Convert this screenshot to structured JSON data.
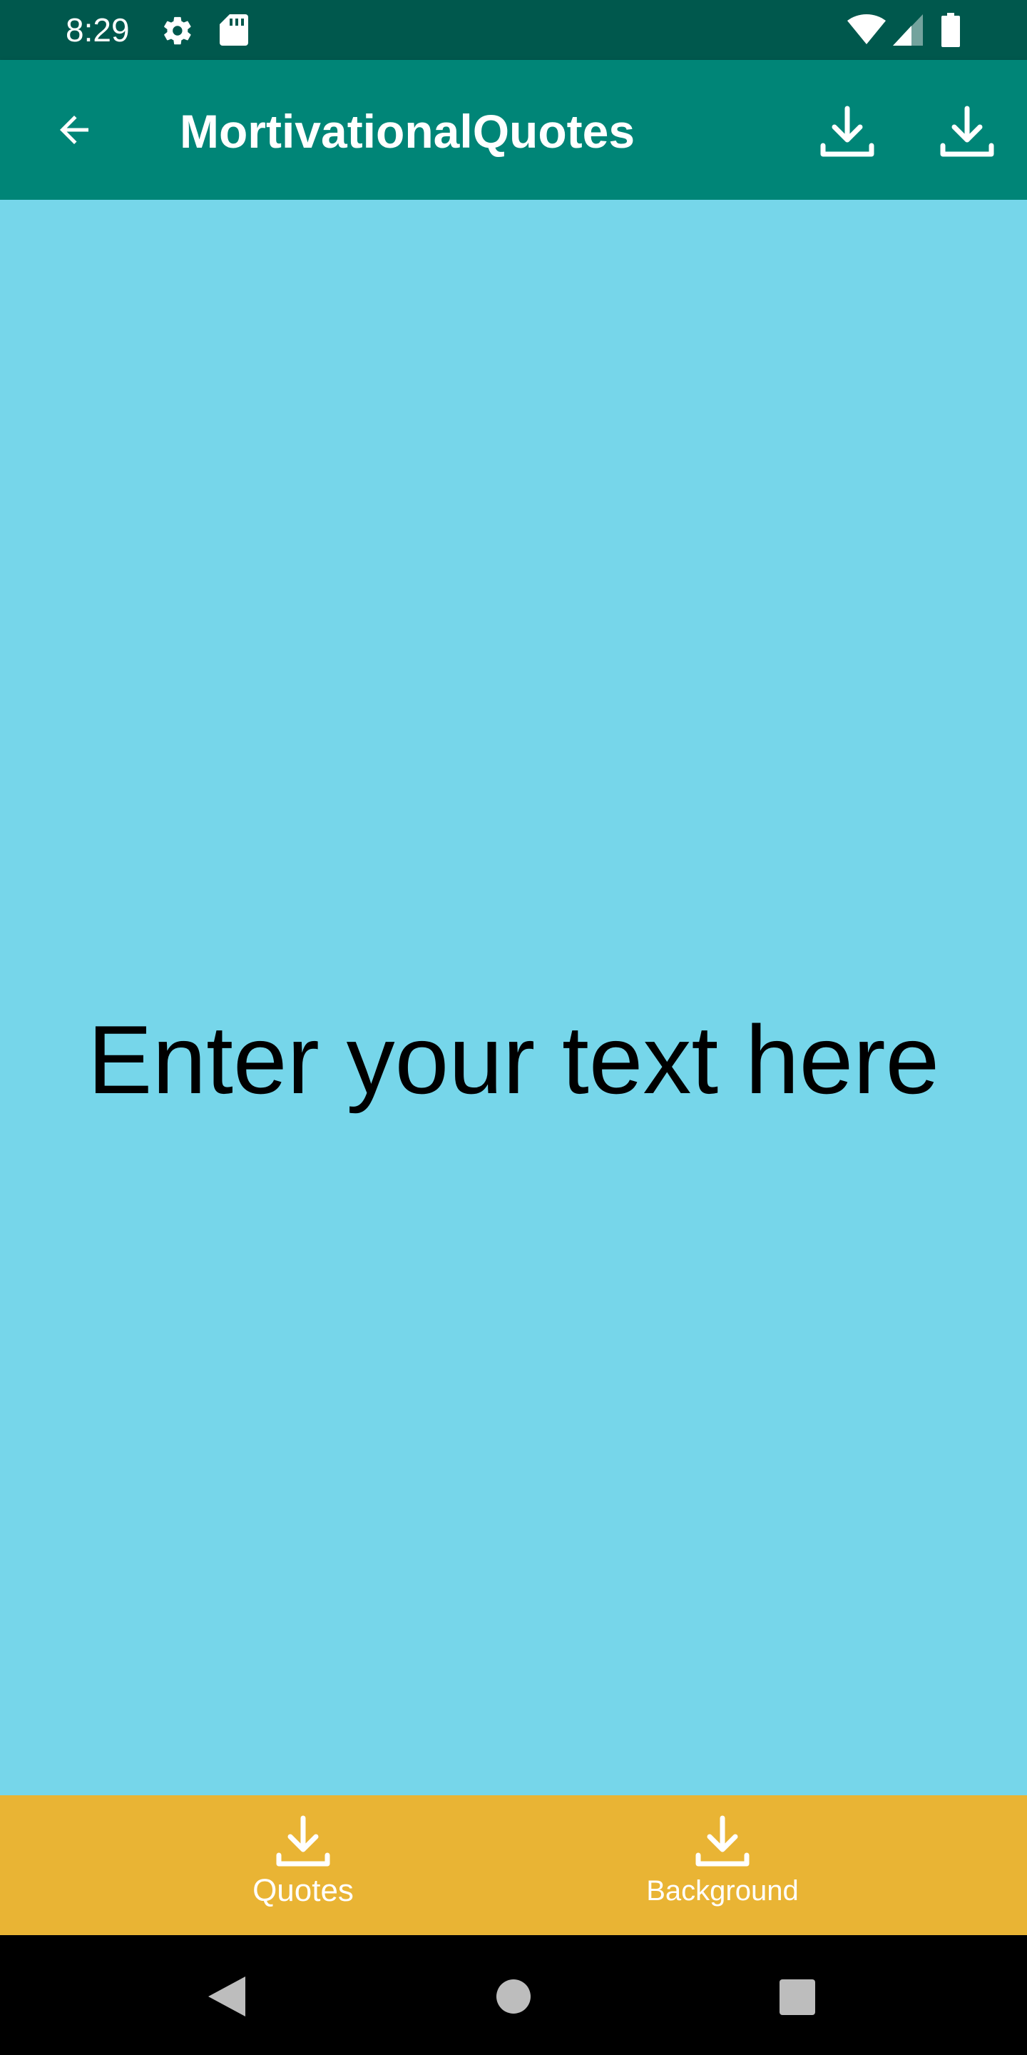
{
  "status_bar": {
    "time": "8:29",
    "icons": [
      "gear-icon",
      "sd-card-icon",
      "wifi-icon",
      "cell-signal-icon",
      "battery-icon"
    ]
  },
  "app_bar": {
    "title": "MortivationalQuotes",
    "back_icon": "arrow-back-icon",
    "actions": [
      "download-icon",
      "download-icon"
    ]
  },
  "content": {
    "quote_text": "Enter your text here",
    "background_color": "#76d6ea"
  },
  "bottom_nav": {
    "items": [
      {
        "label": "Quotes",
        "icon": "download-icon"
      },
      {
        "label": "Background",
        "icon": "download-icon"
      }
    ],
    "background_color": "#e9b434"
  },
  "system_nav": {
    "icons": [
      "back-triangle-icon",
      "home-circle-icon",
      "recents-square-icon"
    ]
  },
  "colors": {
    "status_bar": "#00584d",
    "app_bar": "#008577"
  }
}
